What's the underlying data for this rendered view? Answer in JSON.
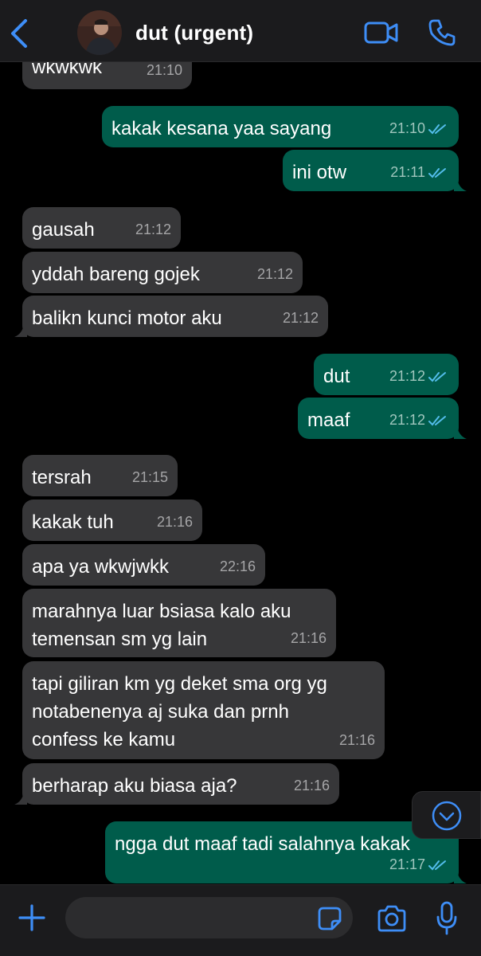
{
  "header": {
    "title": "dut (urgent)",
    "accent_color": "#3e8ef7"
  },
  "messages": [
    {
      "id": "m0",
      "dir": "in",
      "text": "wkwkwk",
      "time": "21:10"
    },
    {
      "id": "m1",
      "dir": "out",
      "text": "kakak kesana yaa sayang",
      "time": "21:10"
    },
    {
      "id": "m2",
      "dir": "out",
      "text": "ini otw",
      "time": "21:11"
    },
    {
      "id": "m3",
      "dir": "in",
      "text": "gausah",
      "time": "21:12"
    },
    {
      "id": "m4",
      "dir": "in",
      "text": "yddah bareng gojek",
      "time": "21:12"
    },
    {
      "id": "m5",
      "dir": "in",
      "text": "balikn kunci motor aku",
      "time": "21:12"
    },
    {
      "id": "m6",
      "dir": "out",
      "text": "dut",
      "time": "21:12"
    },
    {
      "id": "m7",
      "dir": "out",
      "text": "maaf",
      "time": "21:12"
    },
    {
      "id": "m8",
      "dir": "in",
      "text": "tersrah",
      "time": "21:15"
    },
    {
      "id": "m9",
      "dir": "in",
      "text": "kakak tuh",
      "time": "21:16"
    },
    {
      "id": "m10",
      "dir": "in",
      "text": "apa ya wkwjwkk",
      "time": "22:16"
    },
    {
      "id": "m11",
      "dir": "in",
      "text": "marahnya luar bsiasa kalo aku\ntemensan sm yg lain",
      "time": "21:16"
    },
    {
      "id": "m12",
      "dir": "in",
      "text": "tapi giliran km yg deket sma org yg\nnotabenenya aj suka dan prnh\nconfess ke kamu",
      "time": "21:16"
    },
    {
      "id": "m13",
      "dir": "in",
      "text": "berharap aku biasa aja?",
      "time": "21:16"
    },
    {
      "id": "m14",
      "dir": "out",
      "text": "ngga dut maaf tadi salahnya kakak",
      "time": "21:17"
    }
  ],
  "colors": {
    "incoming_bubble": "#373739",
    "outgoing_bubble": "#005c4b",
    "read_tick": "#53bdeb",
    "background": "#000000"
  },
  "icons": {
    "back": "chevron-left-icon",
    "video": "video-camera-icon",
    "call": "phone-icon",
    "scroll_down": "chevron-down-circle-icon",
    "plus": "plus-icon",
    "sticker": "sticker-icon",
    "camera": "camera-icon",
    "mic": "microphone-icon"
  },
  "input": {
    "placeholder": "",
    "value": ""
  }
}
